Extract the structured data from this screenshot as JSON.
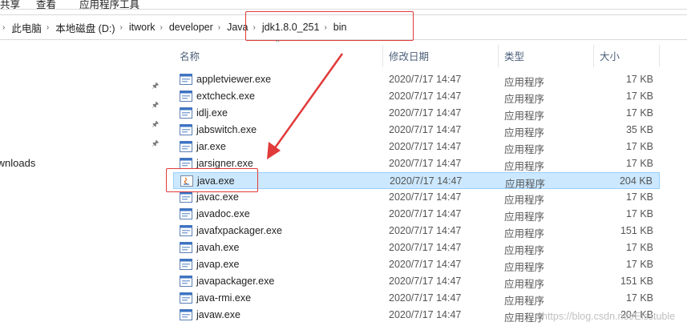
{
  "ribbon": {
    "tabs": [
      "共享",
      "查看",
      "应用程序工具"
    ]
  },
  "address": {
    "crumbs": [
      "此电脑",
      "本地磁盘 (D:)",
      "itwork",
      "developer",
      "Java",
      "jdk1.8.0_251",
      "bin"
    ]
  },
  "nav": {
    "item_label": "Downloads"
  },
  "columns": {
    "name": "名称",
    "date": "修改日期",
    "type": "类型",
    "size": "大小"
  },
  "files": [
    {
      "name": "appletviewer.exe",
      "date": "2020/7/17 14:47",
      "type": "应用程序",
      "size": "17 KB"
    },
    {
      "name": "extcheck.exe",
      "date": "2020/7/17 14:47",
      "type": "应用程序",
      "size": "17 KB"
    },
    {
      "name": "idlj.exe",
      "date": "2020/7/17 14:47",
      "type": "应用程序",
      "size": "17 KB"
    },
    {
      "name": "jabswitch.exe",
      "date": "2020/7/17 14:47",
      "type": "应用程序",
      "size": "35 KB"
    },
    {
      "name": "jar.exe",
      "date": "2020/7/17 14:47",
      "type": "应用程序",
      "size": "17 KB"
    },
    {
      "name": "jarsigner.exe",
      "date": "2020/7/17 14:47",
      "type": "应用程序",
      "size": "17 KB"
    },
    {
      "name": "java.exe",
      "date": "2020/7/17 14:47",
      "type": "应用程序",
      "size": "204 KB",
      "selected": true
    },
    {
      "name": "javac.exe",
      "date": "2020/7/17 14:47",
      "type": "应用程序",
      "size": "17 KB"
    },
    {
      "name": "javadoc.exe",
      "date": "2020/7/17 14:47",
      "type": "应用程序",
      "size": "17 KB"
    },
    {
      "name": "javafxpackager.exe",
      "date": "2020/7/17 14:47",
      "type": "应用程序",
      "size": "151 KB"
    },
    {
      "name": "javah.exe",
      "date": "2020/7/17 14:47",
      "type": "应用程序",
      "size": "17 KB"
    },
    {
      "name": "javap.exe",
      "date": "2020/7/17 14:47",
      "type": "应用程序",
      "size": "17 KB"
    },
    {
      "name": "javapackager.exe",
      "date": "2020/7/17 14:47",
      "type": "应用程序",
      "size": "151 KB"
    },
    {
      "name": "java-rmi.exe",
      "date": "2020/7/17 14:47",
      "type": "应用程序",
      "size": "17 KB"
    },
    {
      "name": "javaw.exe",
      "date": "2020/7/17 14:47",
      "type": "应用程序",
      "size": "204 KB"
    }
  ],
  "watermark": "https://blog.csdn.net/Eisstuble",
  "colors": {
    "annotation": "#e03a3a",
    "selection_bg": "#cce8ff",
    "selection_border": "#99d1ff",
    "header_text": "#4c607a"
  }
}
